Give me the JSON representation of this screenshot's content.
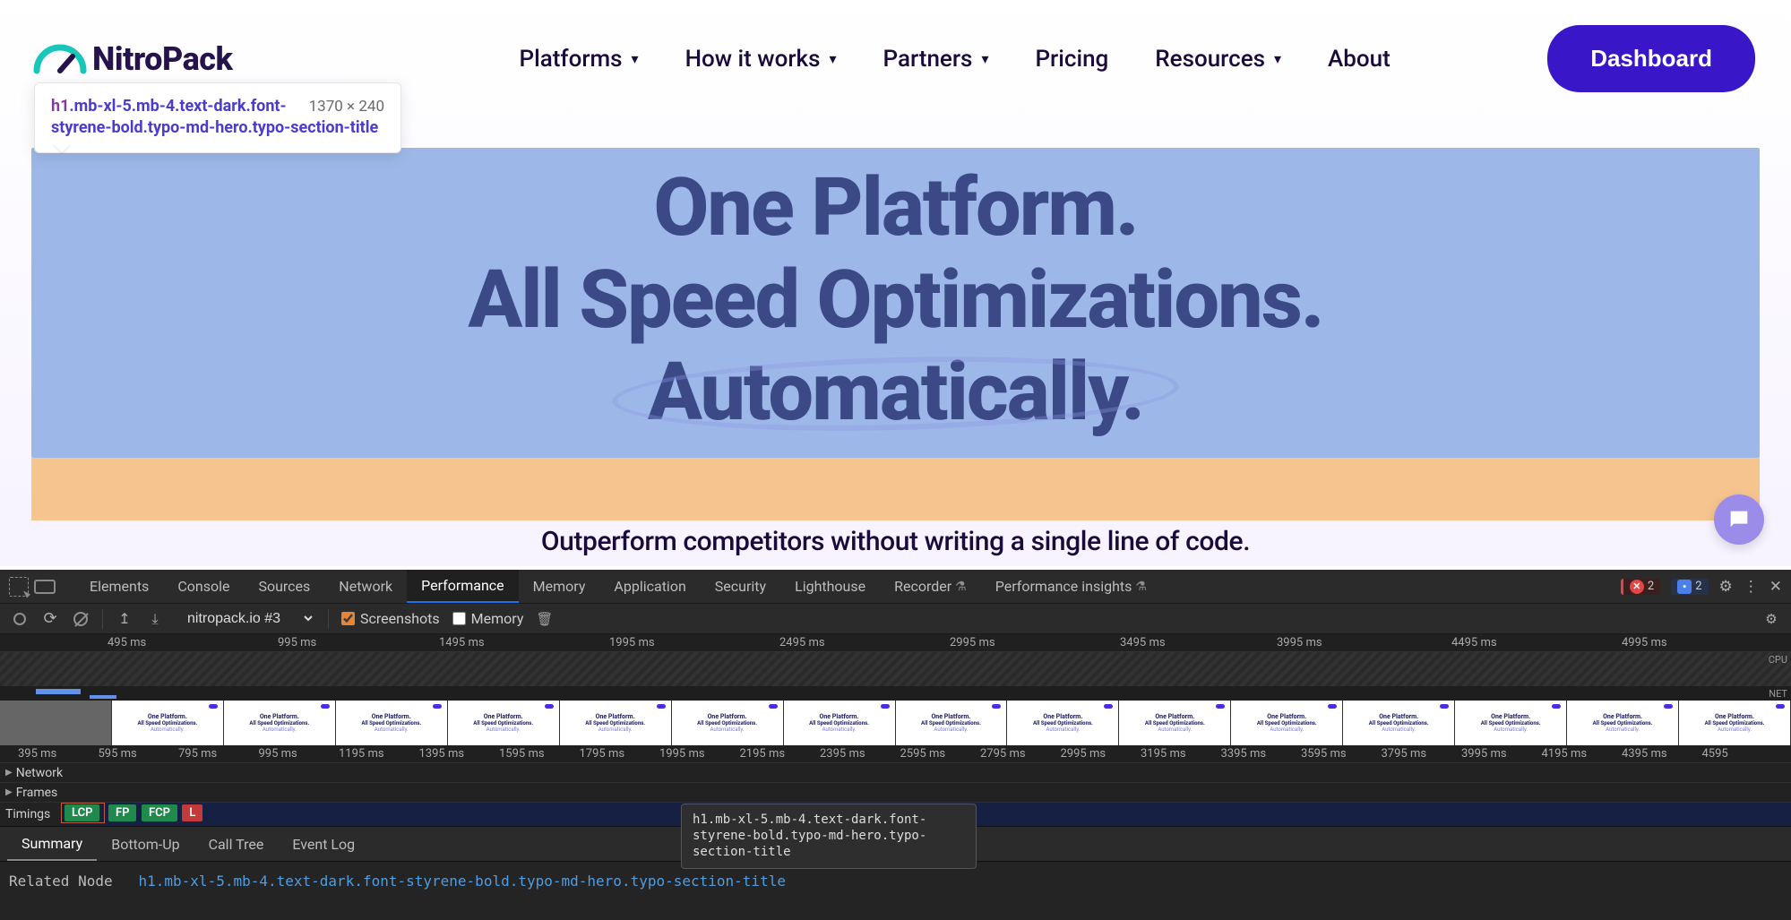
{
  "tooltip": {
    "selector_tag": "h1",
    "selector_classes": ".mb-xl-5.mb-4.text-dark.font-styrene-bold.typo-md-hero.typo-section-title",
    "dimensions": "1370 × 240"
  },
  "nav": {
    "logo": "NitroPack",
    "items": [
      "Platforms",
      "How it works",
      "Partners",
      "Pricing",
      "Resources",
      "About"
    ],
    "items_caret": [
      true,
      true,
      true,
      false,
      true,
      false
    ],
    "dashboard": "Dashboard"
  },
  "hero": {
    "line1": "One Platform.",
    "line2": "All Speed Optimizations.",
    "line3": "Automatically.",
    "sub": "Outperform competitors without writing a single line of code."
  },
  "devtools": {
    "tabs": [
      "Elements",
      "Console",
      "Sources",
      "Network",
      "Performance",
      "Memory",
      "Application",
      "Security",
      "Lighthouse",
      "Recorder",
      "Performance insights"
    ],
    "tabs_flask": [
      false,
      false,
      false,
      false,
      false,
      false,
      false,
      false,
      false,
      true,
      true
    ],
    "active_tab": "Performance",
    "errors": "2",
    "issues": "2",
    "toolbar": {
      "profile": "nitropack.io #3",
      "screenshots_label": "Screenshots",
      "screenshots_checked": true,
      "memory_label": "Memory",
      "memory_checked": false
    },
    "overview_ticks": [
      "495 ms",
      "995 ms",
      "1495 ms",
      "1995 ms",
      "2495 ms",
      "2995 ms",
      "3495 ms",
      "3995 ms",
      "4495 ms",
      "4995 ms"
    ],
    "overview_labels": {
      "cpu": "CPU",
      "net": "NET"
    },
    "ruler2_ticks": [
      "395 ms",
      "595 ms",
      "795 ms",
      "995 ms",
      "1195 ms",
      "1395 ms",
      "1595 ms",
      "1795 ms",
      "1995 ms",
      "2195 ms",
      "2395 ms",
      "2595 ms",
      "2795 ms",
      "2995 ms",
      "3195 ms",
      "3395 ms",
      "3595 ms",
      "3795 ms",
      "3995 ms",
      "4195 ms",
      "4395 ms",
      "4595"
    ],
    "tracks": {
      "network": "Network",
      "frames": "Frames",
      "timings": "Timings"
    },
    "timing_badges": {
      "lcp": "LCP",
      "fp": "FP",
      "fcp": "FCP",
      "l": "L"
    },
    "detail_tabs": [
      "Summary",
      "Bottom-Up",
      "Call Tree",
      "Event Log"
    ],
    "detail_active": "Summary",
    "hover_tip": "h1.mb-xl-5.mb-4.text-dark.font-styrene-bold.typo-md-hero.typo-section-title",
    "related_label": "Related Node",
    "related_value": "h1.mb-xl-5.mb-4.text-dark.font-styrene-bold.typo-md-hero.typo-section-title",
    "filmstrip_thumb": {
      "l1": "One Platform.",
      "l2": "All Speed Optimizations.",
      "l3": "Automatically."
    }
  }
}
